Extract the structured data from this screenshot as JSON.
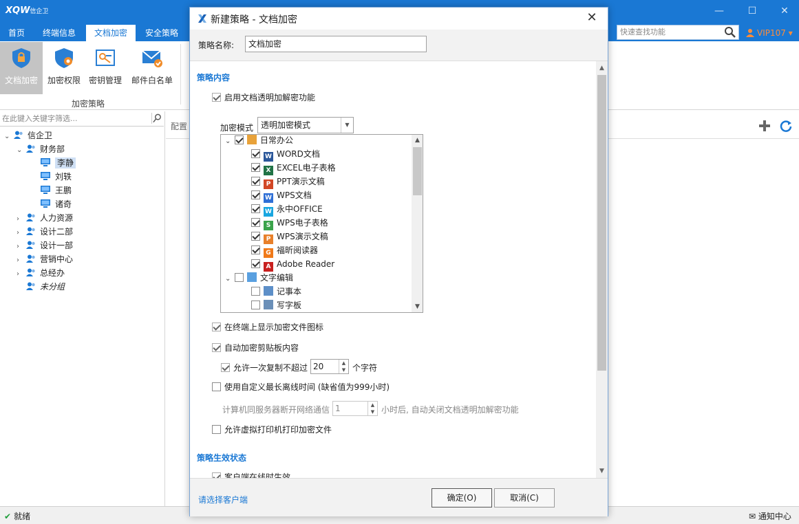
{
  "app": {
    "logo_main": "XQW",
    "logo_sub": "信企卫",
    "window_controls": {
      "minimize": "—",
      "maximize": "☐",
      "close": "✕"
    }
  },
  "menu": {
    "items": [
      {
        "label": "首页"
      },
      {
        "label": "终端信息"
      },
      {
        "label": "文档加密"
      },
      {
        "label": "安全策略"
      }
    ],
    "active_index": 2,
    "search_placeholder": "快速查找功能",
    "vip_label": "VIP107 ▾"
  },
  "ribbon": {
    "buttons": [
      {
        "label": "文档加密",
        "icon": "shield-lock-icon"
      },
      {
        "label": "加密权限",
        "icon": "shield-gear-icon"
      },
      {
        "label": "密钥管理",
        "icon": "key-card-icon"
      },
      {
        "label": "邮件白名单",
        "icon": "mail-check-icon"
      }
    ],
    "group_label": "加密策略"
  },
  "left_pane": {
    "filter_placeholder": "在此键入关键字筛选...",
    "tree": [
      {
        "label": "信企卫",
        "level": 0,
        "type": "group",
        "expanded": true
      },
      {
        "label": "财务部",
        "level": 1,
        "type": "group",
        "expanded": true
      },
      {
        "label": "李静",
        "level": 2,
        "type": "pc",
        "selected": true
      },
      {
        "label": "刘轶",
        "level": 2,
        "type": "pc"
      },
      {
        "label": "王鹏",
        "level": 2,
        "type": "pc"
      },
      {
        "label": "诸奇",
        "level": 2,
        "type": "pc"
      },
      {
        "label": "人力资源",
        "level": 1,
        "type": "group",
        "expanded": false
      },
      {
        "label": "设计二部",
        "level": 1,
        "type": "group",
        "expanded": false
      },
      {
        "label": "设计一部",
        "level": 1,
        "type": "group",
        "expanded": false
      },
      {
        "label": "营销中心",
        "level": 1,
        "type": "group",
        "expanded": false
      },
      {
        "label": "总经办",
        "level": 1,
        "type": "group",
        "expanded": false
      },
      {
        "label": "未分组",
        "level": 1,
        "type": "group",
        "italic": true
      }
    ]
  },
  "content": {
    "label": "配置"
  },
  "status": {
    "text": "就绪",
    "notice": "通知中心"
  },
  "dialog": {
    "title": "新建策略 - 文档加密",
    "name_label": "策略名称:",
    "name_value": "文档加密",
    "section1": "策略内容",
    "enable_transparent": {
      "label": "启用文档透明加解密功能",
      "checked": true
    },
    "mode_label": "加密模式",
    "mode_value": "透明加密模式",
    "app_tree": [
      {
        "label": "日常办公",
        "level": 0,
        "expanded": true,
        "checked": true,
        "icon": "office-folder-icon",
        "color": "#e8a23a"
      },
      {
        "label": "WORD文档",
        "level": 1,
        "checked": true,
        "icon": "word-icon",
        "color": "#2b579a",
        "glyph": "W"
      },
      {
        "label": "EXCEL电子表格",
        "level": 1,
        "checked": true,
        "icon": "excel-icon",
        "color": "#217346",
        "glyph": "X"
      },
      {
        "label": "PPT演示文稿",
        "level": 1,
        "checked": true,
        "icon": "ppt-icon",
        "color": "#d24726",
        "glyph": "P"
      },
      {
        "label": "WPS文档",
        "level": 1,
        "checked": true,
        "icon": "wps-writer-icon",
        "color": "#2f6fd6",
        "glyph": "W"
      },
      {
        "label": "永中OFFICE",
        "level": 1,
        "checked": true,
        "icon": "yozo-office-icon",
        "color": "#19a6e0",
        "glyph": "W"
      },
      {
        "label": "WPS电子表格",
        "level": 1,
        "checked": true,
        "icon": "wps-sheet-icon",
        "color": "#3aa34a",
        "glyph": "S"
      },
      {
        "label": "WPS演示文稿",
        "level": 1,
        "checked": true,
        "icon": "wps-present-icon",
        "color": "#e8802a",
        "glyph": "P"
      },
      {
        "label": "福昕阅读器",
        "level": 1,
        "checked": true,
        "icon": "foxit-reader-icon",
        "color": "#f07a1a",
        "glyph": "G"
      },
      {
        "label": "Adobe Reader",
        "level": 1,
        "checked": true,
        "icon": "adobe-reader-icon",
        "color": "#c8201f",
        "glyph": "A"
      },
      {
        "label": "文字编辑",
        "level": 0,
        "expanded": true,
        "checked": false,
        "icon": "edit-folder-icon",
        "color": "#5aa0e0"
      },
      {
        "label": "记事本",
        "level": 1,
        "checked": false,
        "icon": "notepad-icon",
        "color": "#5d8fc8",
        "glyph": ""
      },
      {
        "label": "写字板",
        "level": 1,
        "checked": false,
        "icon": "wordpad-icon",
        "color": "#6a8fb8",
        "glyph": ""
      }
    ],
    "show_icon": {
      "label": "在终端上显示加密文件图标",
      "checked": true
    },
    "auto_clipboard": {
      "label": "自动加密剪贴板内容",
      "checked": true
    },
    "copy_limit": {
      "label_before": "允许一次复制不超过",
      "value": "20",
      "label_after": "个字符",
      "checked": true
    },
    "offline_time": {
      "label": "使用自定义最长离线时间 (缺省值为999小时)",
      "checked": false
    },
    "disconnect": {
      "label_before": "计算机同服务器断开网络通信",
      "value": "1",
      "label_after": "小时后, 自动关闭文档透明加解密功能"
    },
    "virtual_print": {
      "label": "允许虚拟打印机打印加密文件",
      "checked": false
    },
    "section2": "策略生效状态",
    "effective_partial": "客户端在线时生效",
    "footer_link": "请选择客户端",
    "ok_label": "确定(O)",
    "cancel_label": "取消(C)"
  }
}
